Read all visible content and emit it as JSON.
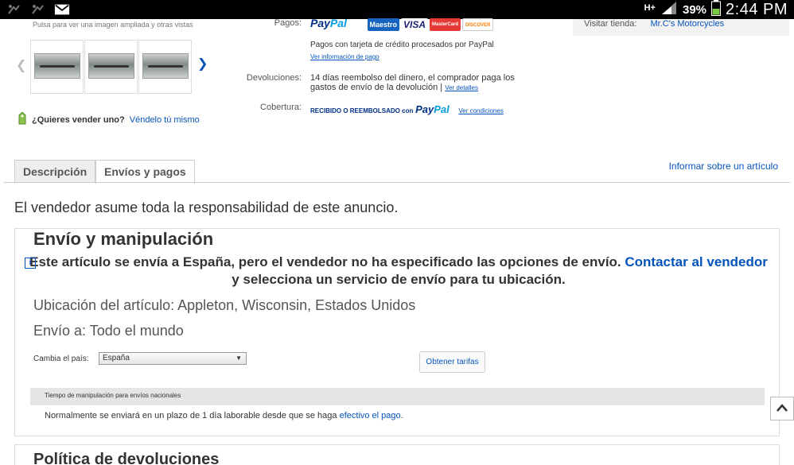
{
  "status_bar": {
    "network": "H+",
    "battery": "39%",
    "time": "2:44 PM"
  },
  "gallery": {
    "hint": "Pulsa para ver una imagen ampliada y otras vistas"
  },
  "sell": {
    "question": "¿Quieres vender uno?",
    "link": "Véndelo tú mismo"
  },
  "payment": {
    "label": "Pagos:",
    "paypal_pay": "Pay",
    "paypal_pal": "Pal",
    "cards": [
      "Maestro",
      "VISA",
      "MasterCard",
      "DISCOVER"
    ],
    "note": "Pagos con tarjeta de crédito procesados por PayPal",
    "info_link": "Ver información de pago"
  },
  "returns": {
    "label": "Devoluciones:",
    "text": "14 días reembolso del dinero, el comprador paga los gastos de envío de la devolución |",
    "link": "Ver detalles"
  },
  "coverage": {
    "label": "Cobertura:",
    "text": "RECIBIDO O REEMBOLSADO con",
    "paypal_pay": "Pay",
    "paypal_pal": "Pal",
    "link": "Ver condiciones"
  },
  "seller_box": {
    "text": "Visitar tienda:",
    "store": "Mr.C's Motorcycles"
  },
  "tabs": [
    {
      "label": "Descripción"
    },
    {
      "label": "Envíos y pagos"
    }
  ],
  "report_link": "Informar sobre un artículo",
  "responsibility": "El vendedor asume toda la responsabilidad de este anuncio.",
  "shipping": {
    "title": "Envío y manipulación",
    "notice_text": "Este artículo se envía a España, pero el vendedor no ha especificado las opciones de envío.",
    "notice_link": "Contactar al vendedor",
    "notice_tail": "y selecciona un servicio de envío para tu ubicación.",
    "location": "Ubicación del artículo: Appleton, Wisconsin, Estados Unidos",
    "ship_to": "Envío a: Todo el mundo",
    "country_label": "Cambia el país:",
    "country_value": "España",
    "rates_button": "Obtener tarifas",
    "handling_header": "Tiempo de manipulación para envíos nacionales",
    "handling_text": "Normalmente se enviará en un plazo de 1 día laborable desde que se haga",
    "handling_link": "efectivo el pago",
    "handling_end": "."
  },
  "returns_section": {
    "title": "Política de devoluciones"
  }
}
